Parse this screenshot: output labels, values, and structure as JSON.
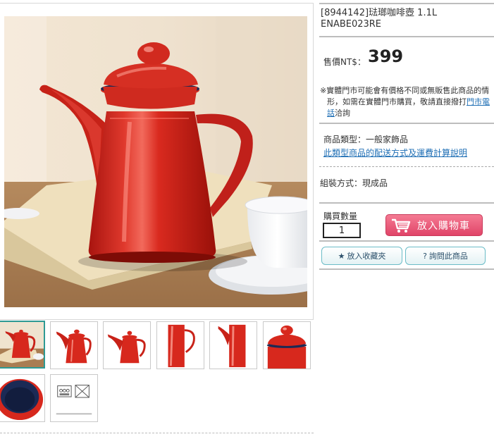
{
  "product": {
    "title_line1": "[8944142]琺瑯咖啡壺 1.1L",
    "title_line2": "ENABE023RE",
    "price_label": "售價NT$：",
    "price_value": "399",
    "note_line1": "※實體門市可能會有價格不同或無販售此商品的情",
    "note_line2_pre": "形，如需在實體門市購買，敬請直接撥打",
    "note_link": "門市電話",
    "note_link_a": "門市電",
    "note_link_b": "話",
    "note_post": "洽詢",
    "category_label": "商品類型：一般家飾品",
    "category_link": "此類型商品的配送方式及運費計算說明",
    "assembly": "組裝方式：現成品"
  },
  "purchase": {
    "qty_label": "購買數量",
    "qty_value": "1",
    "add_to_cart": "放入購物車",
    "favorite": "放入收藏夾",
    "favorite_icon": "star-icon",
    "inquire": "詢問此商品",
    "inquire_icon": "question-icon"
  },
  "thumbnails": [
    {
      "name": "thumb-1",
      "kind": "teapot-scene"
    },
    {
      "name": "thumb-2",
      "kind": "teapot-left"
    },
    {
      "name": "thumb-3",
      "kind": "teapot-left-small"
    },
    {
      "name": "thumb-4",
      "kind": "teapot-side"
    },
    {
      "name": "thumb-5",
      "kind": "teapot-spout"
    },
    {
      "name": "thumb-6",
      "kind": "teapot-top"
    },
    {
      "name": "thumb-7",
      "kind": "teapot-inside"
    },
    {
      "name": "thumb-8",
      "kind": "care-symbols"
    }
  ],
  "colors": {
    "accent_red": "#d9261c",
    "cart_pink": "#e04468",
    "link_blue": "#1f6fb5",
    "teal_border": "#2e9a94"
  }
}
